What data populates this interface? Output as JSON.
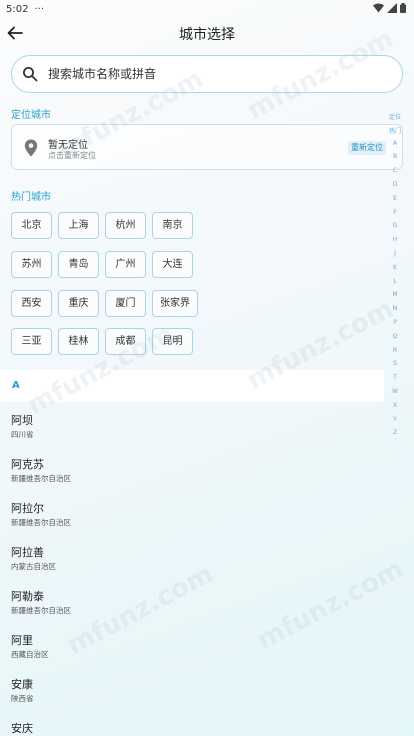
{
  "status_bar": {
    "time": "5:02",
    "dots": "···"
  },
  "app_bar": {
    "title": "城市选择"
  },
  "search": {
    "placeholder": "搜索城市名称或拼音"
  },
  "location": {
    "section_label": "定位城市",
    "title": "暂无定位",
    "subtitle": "点击重新定位",
    "relocate_label": "重新定位"
  },
  "hot": {
    "section_label": "热门城市",
    "cities": [
      "北京",
      "上海",
      "杭州",
      "南京",
      "苏州",
      "青岛",
      "广州",
      "大连",
      "西安",
      "重庆",
      "厦门",
      "张家界",
      "三亚",
      "桂林",
      "成都",
      "昆明"
    ]
  },
  "list": {
    "letter": "A",
    "cities": [
      {
        "name": "阿坝",
        "province": "四川省"
      },
      {
        "name": "阿克苏",
        "province": "新疆维吾尔自治区"
      },
      {
        "name": "阿拉尔",
        "province": "新疆维吾尔自治区"
      },
      {
        "name": "阿拉善",
        "province": "内蒙古自治区"
      },
      {
        "name": "阿勒泰",
        "province": "新疆维吾尔自治区"
      },
      {
        "name": "阿里",
        "province": "西藏自治区"
      },
      {
        "name": "安康",
        "province": "陕西省"
      },
      {
        "name": "安庆",
        "province": ""
      }
    ]
  },
  "index_bar": [
    "定位",
    "热门",
    "A",
    "B",
    "C",
    "D",
    "E",
    "F",
    "G",
    "H",
    "J",
    "K",
    "L",
    "M",
    "N",
    "P",
    "Q",
    "R",
    "S",
    "T",
    "W",
    "X",
    "Y",
    "Z"
  ],
  "watermark": "mfunz.com",
  "colors": {
    "accent": "#2a9fcf",
    "border": "#a8d6e4"
  }
}
